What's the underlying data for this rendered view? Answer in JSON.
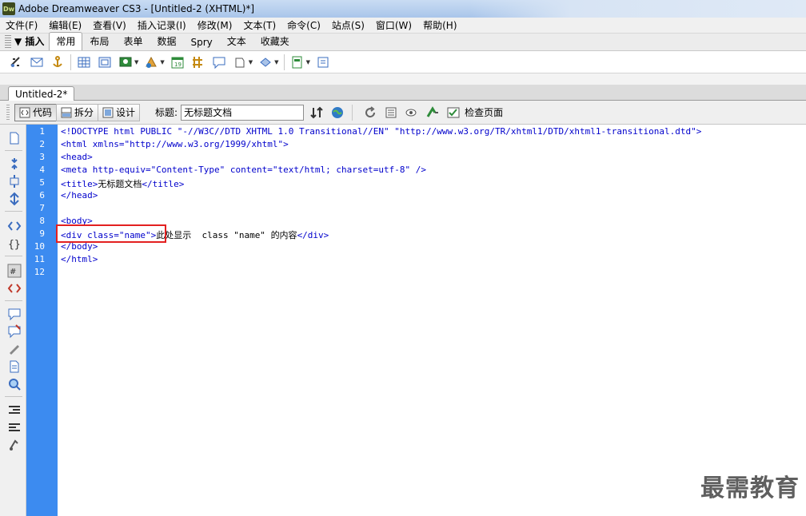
{
  "window": {
    "app_icon": "Dw",
    "title": "Adobe Dreamweaver CS3 - [Untitled-2 (XHTML)*]"
  },
  "menu": [
    "文件(F)",
    "编辑(E)",
    "查看(V)",
    "插入记录(I)",
    "修改(M)",
    "文本(T)",
    "命令(C)",
    "站点(S)",
    "窗口(W)",
    "帮助(H)"
  ],
  "insert_bar": {
    "panel_title": "▼ 插入",
    "tabs": [
      "常用",
      "布局",
      "表单",
      "数据",
      "Spry",
      "文本",
      "收藏夹"
    ],
    "active_tab": "常用"
  },
  "document": {
    "tab_name": "Untitled-2*",
    "views": [
      "代码",
      "拆分",
      "设计"
    ],
    "active_view": "代码",
    "title_label": "标题:",
    "title_value": "无标题文档",
    "check_page_label": "检查页面"
  },
  "code_lines": [
    {
      "n": "1",
      "t": "<!DOCTYPE html PUBLIC \"-//W3C//DTD XHTML 1.0 Transitional//EN\" \"http://www.w3.org/TR/xhtml1/DTD/xhtml1-transitional.dtd\">"
    },
    {
      "n": "2",
      "t": "<html xmlns=\"http://www.w3.org/1999/xhtml\">"
    },
    {
      "n": "3",
      "t": "<head>"
    },
    {
      "n": "4",
      "t": "<meta http-equiv=\"Content-Type\" content=\"text/html; charset=utf-8\" />"
    },
    {
      "n": "5",
      "t": "<title>",
      "cjk": "无标题文档",
      "t2": "</title>"
    },
    {
      "n": "6",
      "t": "</head>"
    },
    {
      "n": "7",
      "t": ""
    },
    {
      "n": "8",
      "t": "<body>"
    },
    {
      "n": "9",
      "t": "<div class=\"name\">",
      "cjk": "此处显示",
      "txt": "  class \"name\" ",
      "cjk2": "的内容",
      "t2": "</div>"
    },
    {
      "n": "10",
      "t": "</body>"
    },
    {
      "n": "11",
      "t": "</html>"
    },
    {
      "n": "12",
      "t": ""
    }
  ],
  "watermark": "最需教育",
  "colors": {
    "gutter": "#3c8bf0",
    "code_tag": "#0000cc",
    "highlight_box": "#e32020"
  }
}
